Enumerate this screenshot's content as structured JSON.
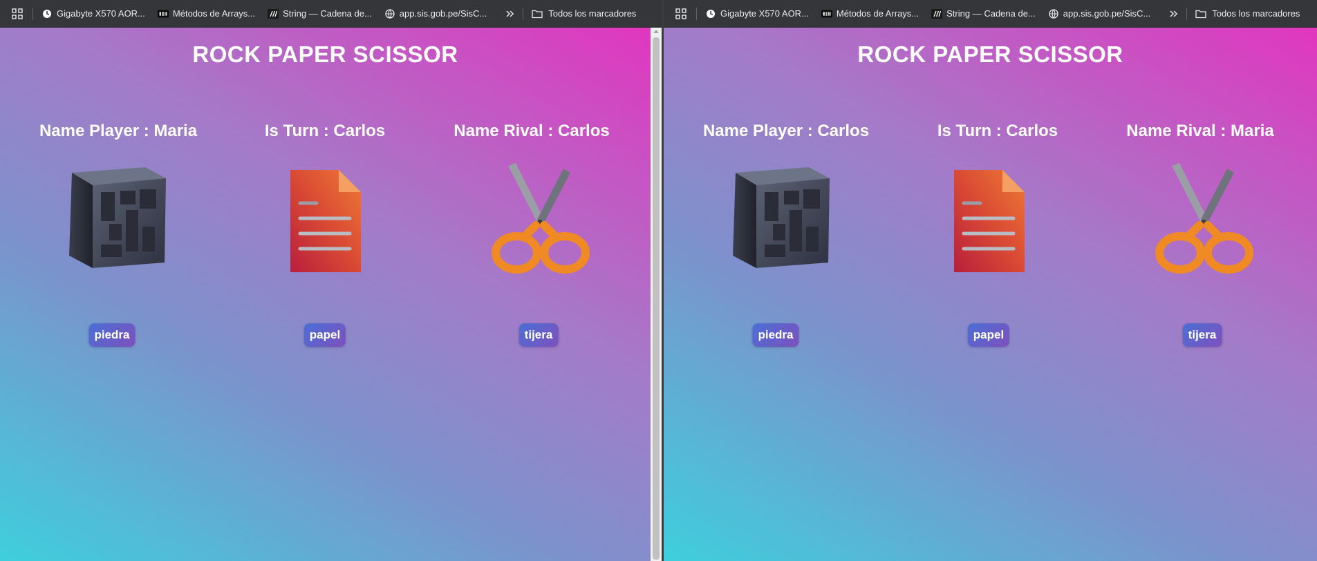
{
  "bookmarks": [
    {
      "label": "Gigabyte X570 AOR...",
      "icon": "clock-icon"
    },
    {
      "label": "Métodos de Arrays...",
      "icon": "dev-icon"
    },
    {
      "label": "String — Cadena de...",
      "icon": "mdn-icon"
    },
    {
      "label": "app.sis.gob.pe/SisC...",
      "icon": "globe-icon"
    }
  ],
  "all_bookmarks_label": "Todos los marcadores",
  "colors": {
    "gradient": [
      "#3ecfdc",
      "#7c92cc",
      "#a57ac8",
      "#e136bf"
    ],
    "button": [
      "#4a6fd6",
      "#7e50bd"
    ],
    "bar": "#35363a"
  },
  "windows": [
    {
      "title": "ROCK PAPER SCISSOR",
      "player": "Name Player : Maria",
      "turn": "Is Turn : Carlos",
      "rival": "Name Rival : Carlos",
      "choices": [
        {
          "label": "piedra",
          "icon": "rock-cube-icon"
        },
        {
          "label": "papel",
          "icon": "paper-document-icon"
        },
        {
          "label": "tijera",
          "icon": "scissors-icon"
        }
      ]
    },
    {
      "title": "ROCK PAPER SCISSOR",
      "player": "Name Player : Carlos",
      "turn": "Is Turn : Carlos",
      "rival": "Name Rival : Maria",
      "choices": [
        {
          "label": "piedra",
          "icon": "rock-cube-icon"
        },
        {
          "label": "papel",
          "icon": "paper-document-icon"
        },
        {
          "label": "tijera",
          "icon": "scissors-icon"
        }
      ]
    }
  ]
}
